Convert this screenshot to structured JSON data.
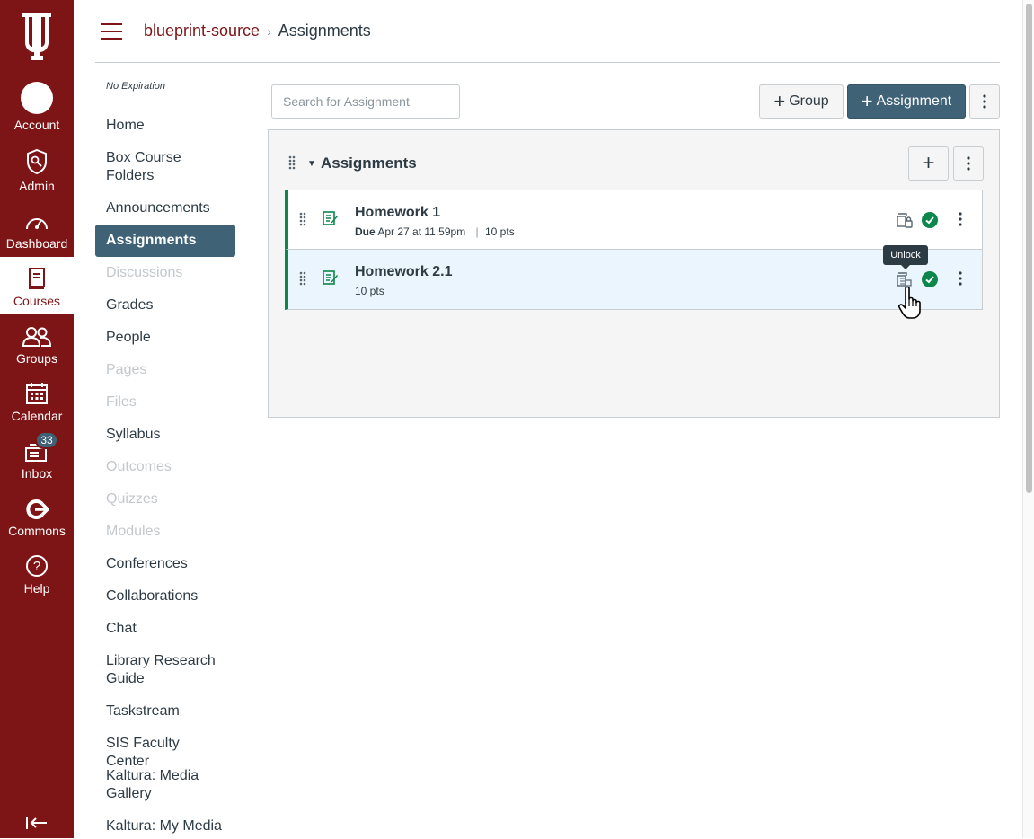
{
  "global_nav": {
    "logo": "IU",
    "items": [
      {
        "label": "Account",
        "icon": "avatar"
      },
      {
        "label": "Admin",
        "icon": "shield-icon"
      },
      {
        "label": "Dashboard",
        "icon": "speedometer-icon"
      },
      {
        "label": "Courses",
        "icon": "book-icon"
      },
      {
        "label": "Groups",
        "icon": "people-icon"
      },
      {
        "label": "Calendar",
        "icon": "calendar-icon"
      },
      {
        "label": "Inbox",
        "icon": "inbox-icon",
        "badge": "33"
      },
      {
        "label": "Commons",
        "icon": "commons-icon"
      },
      {
        "label": "Help",
        "icon": "help-icon"
      }
    ]
  },
  "breadcrumb": {
    "course": "blueprint-source",
    "separator": "›",
    "current": "Assignments"
  },
  "course_nav": {
    "expiration": "No Expiration",
    "items": [
      {
        "label": "Home"
      },
      {
        "label": "Box Course Folders"
      },
      {
        "label": "Announcements"
      },
      {
        "label": "Assignments"
      },
      {
        "label": "Discussions"
      },
      {
        "label": "Grades"
      },
      {
        "label": "People"
      },
      {
        "label": "Pages"
      },
      {
        "label": "Files"
      },
      {
        "label": "Syllabus"
      },
      {
        "label": "Outcomes"
      },
      {
        "label": "Quizzes"
      },
      {
        "label": "Modules"
      },
      {
        "label": "Conferences"
      },
      {
        "label": "Collaborations"
      },
      {
        "label": "Chat"
      },
      {
        "label": "Library Research Guide"
      },
      {
        "label": "Taskstream"
      },
      {
        "label": "SIS Faculty Center"
      },
      {
        "label": "Kaltura: Media Gallery"
      },
      {
        "label": "Kaltura: My Media"
      }
    ]
  },
  "toolbar": {
    "search_placeholder": "Search for Assignment",
    "group_label": "Group",
    "assignment_label": "Assignment"
  },
  "group": {
    "title": "Assignments",
    "assignments": [
      {
        "title": "Homework 1",
        "due_label": "Due",
        "due": "Apr 27 at 11:59pm",
        "points": "10 pts"
      },
      {
        "title": "Homework 2.1",
        "points": "10 pts"
      }
    ]
  },
  "tooltip": "Unlock",
  "colors": {
    "brand": "#7d1416",
    "accent": "#3f6276",
    "published": "#0b874b"
  }
}
